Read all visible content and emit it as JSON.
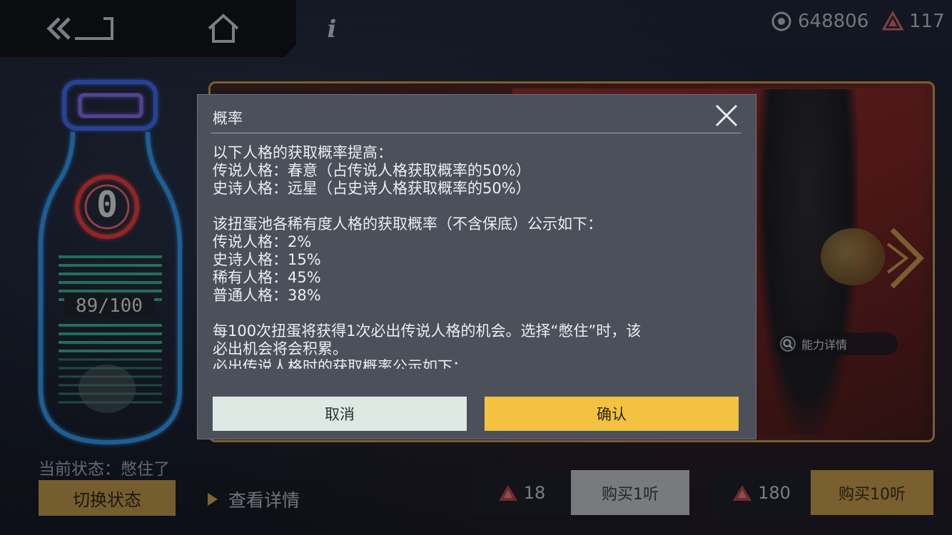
{
  "topbar": {
    "back_icon": "double-chevron-back-icon",
    "home_icon": "home-icon",
    "info_label": "i"
  },
  "currency": {
    "coins_icon": "eye-coin-icon",
    "coins": "648806",
    "gems_icon": "triangle-gem-icon",
    "gems": "117"
  },
  "bottle": {
    "count": "0",
    "progress": "89/100",
    "progress_fraction": 0.89
  },
  "status": {
    "current_state": "当前状态：憋住了",
    "switch_label": "切换状态",
    "details_label": "查看详情"
  },
  "banner": {
    "ability_label": "能力详情"
  },
  "dialog": {
    "title": "概率",
    "lines": [
      "以下人格的获取概率提高：",
      "传说人格：春意（占传说人格获取概率的50%）",
      "史诗人格：远星（占史诗人格获取概率的50%）",
      "",
      "该扭蛋池各稀有度人格的获取概率（不含保底）公示如下：",
      "传说人格：2%",
      "史诗人格：15%",
      "稀有人格：45%",
      "普通人格：38%",
      "",
      "每100次扭蛋将获得1次必出传说人格的机会。选择“憋住”时，该",
      "必出机会将会积累。",
      "必出传说人格时的获取概率公示如下："
    ],
    "cancel_label": "取消",
    "confirm_label": "确认"
  },
  "purchase": {
    "single_price": "18",
    "single_label": "购买1听",
    "ten_price": "180",
    "ten_label": "购买10听"
  },
  "colors": {
    "accent_gold": "#d6a44a",
    "confirm_yellow": "#f3c240",
    "neon_blue": "#2fa3ff",
    "neon_red": "#ff3b3b"
  }
}
